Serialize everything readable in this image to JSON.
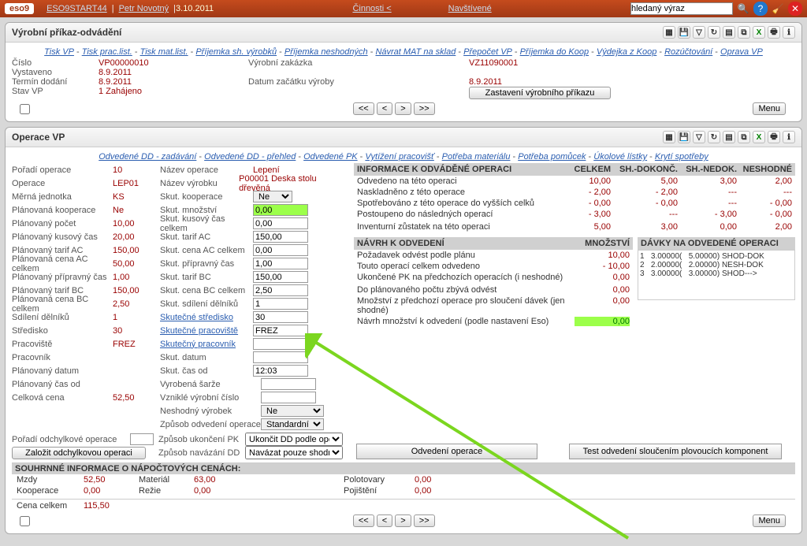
{
  "top": {
    "logo": "eso9",
    "app": "ESO9START44",
    "user": "Petr Novotný",
    "date": "3.10.2011",
    "cinnosti": "Činnosti <",
    "navstivene": "Navštívené",
    "search_value": "hledaný výraz"
  },
  "panel1": {
    "title": "Výrobní příkaz-odvádění",
    "links": [
      "Tisk VP",
      "Tisk prac.list.",
      "Tisk mat.list.",
      "Příjemka sh. výrobků",
      "Příjemka neshodných",
      "Návrat MAT na sklad",
      "Přepočet VP",
      "Příjemka do Koop",
      "Výdejka z Koop",
      "Rozúčtování",
      "Oprava VP"
    ],
    "left_labels": {
      "cislo": "Číslo",
      "vystaveno": "Vystaveno",
      "termin": "Termín dodání",
      "stav": "Stav VP"
    },
    "left_vals": {
      "cislo": "VP00000010",
      "vystaveno": "8.9.2011",
      "termin": "8.9.2011",
      "stav": "1 Zahájeno"
    },
    "mid_labels": {
      "zakazka": "Výrobní zakázka",
      "datum": "Datum začátku výroby"
    },
    "right_vals": {
      "zakazka": "VZ11090001",
      "datum": "8.9.2011"
    },
    "stop_btn": "Zastavení výrobního příkazu",
    "menu": "Menu",
    "nav": [
      "<<",
      "<",
      ">",
      ">>"
    ]
  },
  "panel2": {
    "title": "Operace VP",
    "links": [
      "Odvedené DD - zadávání",
      "Odvedené DD - přehled",
      "Odvedené PK",
      "Vytížení pracovišť",
      "Potřeba materiálu",
      "Potřeba pomůcek",
      "Úkolové lístky",
      "Krytí spotřeby"
    ],
    "col1": [
      {
        "l": "Pořadí operace",
        "v": "10"
      },
      {
        "l": "Operace",
        "v": "LEP01"
      },
      {
        "l": "Měrná jednotka",
        "v": "KS"
      },
      {
        "l": "Plánovaná kooperace",
        "v": "Ne"
      },
      {
        "l": "Plánovaný počet",
        "v": "10,00"
      },
      {
        "l": "Plánovaný kusový čas",
        "v": "20,00"
      },
      {
        "l": "Plánovaný tarif AC",
        "v": "150,00"
      },
      {
        "l": "Plánovaná cena AC celkem",
        "v": "50,00"
      },
      {
        "l": "Plánovaný přípravný čas",
        "v": "1,00"
      },
      {
        "l": "Plánovaný tarif BC",
        "v": "150,00"
      },
      {
        "l": "Plánovaná cena BC celkem",
        "v": "2,50"
      },
      {
        "l": "Sdílení dělníků",
        "v": "1"
      },
      {
        "l": "Středisko",
        "v": "30"
      },
      {
        "l": "Pracoviště",
        "v": "FREZ"
      },
      {
        "l": "Pracovník",
        "v": ""
      },
      {
        "l": "Plánovaný datum",
        "v": ""
      },
      {
        "l": "Plánovaný čas od",
        "v": ""
      },
      {
        "l": "Celková cena",
        "v": "52,50"
      }
    ],
    "col2_top": [
      {
        "l": "Název operace",
        "t": "text",
        "v": "Lepení"
      },
      {
        "l": "Název výrobku",
        "t": "text",
        "v": "P00001 Deska stolu dřevěná"
      },
      {
        "l": "Skut. kooperace",
        "t": "sel",
        "v": "Ne"
      }
    ],
    "col2": [
      {
        "l": "Skut. množství",
        "v": "0,00",
        "g": true
      },
      {
        "l": "Skut. kusový čas celkem",
        "v": "0,00"
      },
      {
        "l": "Skut. tarif AC",
        "v": "150,00"
      },
      {
        "l": "Skut. cena AC celkem",
        "v": "0,00"
      },
      {
        "l": "Skut. přípravný čas",
        "v": "1,00"
      },
      {
        "l": "Skut. tarif BC",
        "v": "150,00"
      },
      {
        "l": "Skut. cena BC celkem",
        "v": "2,50"
      },
      {
        "l": "Skut. sdílení dělníků",
        "v": "1"
      },
      {
        "l": "Skutečné středisko",
        "v": "30",
        "link": true
      },
      {
        "l": "Skutečné pracoviště",
        "v": "FREZ",
        "link": true
      },
      {
        "l": "Skutečný pracovník",
        "v": "",
        "link": true
      },
      {
        "l": "Skut. datum",
        "v": ""
      },
      {
        "l": "Skut. čas od",
        "v": "12:03"
      }
    ],
    "col2_extra": [
      {
        "l": "Vyrobená šarže",
        "v": ""
      },
      {
        "l": "Vzniklé výrobní číslo",
        "v": ""
      },
      {
        "l": "Neshodný výrobek",
        "t": "sel",
        "v": "Ne"
      },
      {
        "l": "Způsob odvedení operace",
        "t": "sel",
        "v": "Standardní"
      }
    ],
    "odchylka_lbl": "Pořadí odchylkové operace",
    "odchylka_btn": "Založit odchylkovou operaci",
    "ukonc_lbl": "Způsob ukončení PK",
    "ukonc_val": "Ukončit DD podle operace",
    "navaz_lbl": "Způsob navázání DD",
    "navaz_val": "Navázat pouze shodné DD",
    "odvedeni_btn": "Odvedení operace",
    "test_btn": "Test odvedení sloučením plovoucích komponent",
    "info_head": {
      "t": "INFORMACE K ODVÁDĚNÉ OPERACI",
      "c1": "CELKEM",
      "c2": "SH.-DOKONČ.",
      "c3": "SH.-NEDOK.",
      "c4": "NESHODNÉ"
    },
    "info_rows": [
      {
        "t": "Odvedeno na této operaci",
        "v": [
          "10,00",
          "5,00",
          "3,00",
          "2,00"
        ]
      },
      {
        "t": "Naskladněno z této operace",
        "v": [
          "- 2,00",
          "- 2,00",
          "---",
          "---"
        ]
      },
      {
        "t": "Spotřebováno z této operace do vyšších celků",
        "v": [
          "- 0,00",
          "- 0,00",
          "---",
          "- 0,00"
        ]
      },
      {
        "t": "Postoupeno do následných operací",
        "v": [
          "- 3,00",
          "---",
          "- 3,00",
          "- 0,00"
        ]
      },
      {
        "t": "",
        "v": [
          "",
          "",
          "",
          ""
        ]
      },
      {
        "t": "Inventurní zůstatek na této operaci",
        "v": [
          "5,00",
          "3,00",
          "0,00",
          "2,00"
        ]
      }
    ],
    "navrh_head": {
      "t": "NÁVRH K ODVEDENÍ",
      "c1": "MNOŽSTVÍ",
      "c2": "DÁVKY NA ODVEDENÉ OPERACI"
    },
    "navrh_rows": [
      {
        "t": "Požadavek odvést podle plánu",
        "v": "10,00"
      },
      {
        "t": "Touto operací celkem odvedeno",
        "v": "- 10,00"
      },
      {
        "t": "Ukončené PK na předchozích operacích (i neshodné)",
        "v": "0,00"
      },
      {
        "t": "",
        "v": ""
      },
      {
        "t": "Do plánovaného počtu zbývá odvést",
        "v": "0,00"
      },
      {
        "t": "Množství z předchozí operace pro sloučení dávek (jen shodné)",
        "v": "0,00"
      },
      {
        "t": "Návrh množství k odvedení (podle nastavení Eso)",
        "v": "0,00",
        "g": true
      }
    ],
    "batches": [
      {
        "n": "1",
        "a": "3.00000(",
        "b": "5.00000) SHOD-DOK"
      },
      {
        "n": "2",
        "a": "2.00000(",
        "b": "2.00000) NESH-DOK"
      },
      {
        "n": "3",
        "a": "3.00000(",
        "b": "3.00000) SHOD--->"
      }
    ],
    "ceny_title": "SOUHRNNÉ INFORMACE O NÁPOČTOVÝCH CENÁCH:",
    "ceny": [
      {
        "l": "Mzdy",
        "v": "52,50",
        "l2": "Materiál",
        "v2": "63,00",
        "l3": "Polotovary",
        "v3": "0,00"
      },
      {
        "l": "Kooperace",
        "v": "0,00",
        "l2": "Režie",
        "v2": "0,00",
        "l3": "Pojištění",
        "v3": "0,00"
      }
    ],
    "cena_celkem_l": "Cena celkem",
    "cena_celkem_v": "115,50",
    "menu": "Menu",
    "nav": [
      "<<",
      "<",
      ">",
      ">>"
    ]
  }
}
